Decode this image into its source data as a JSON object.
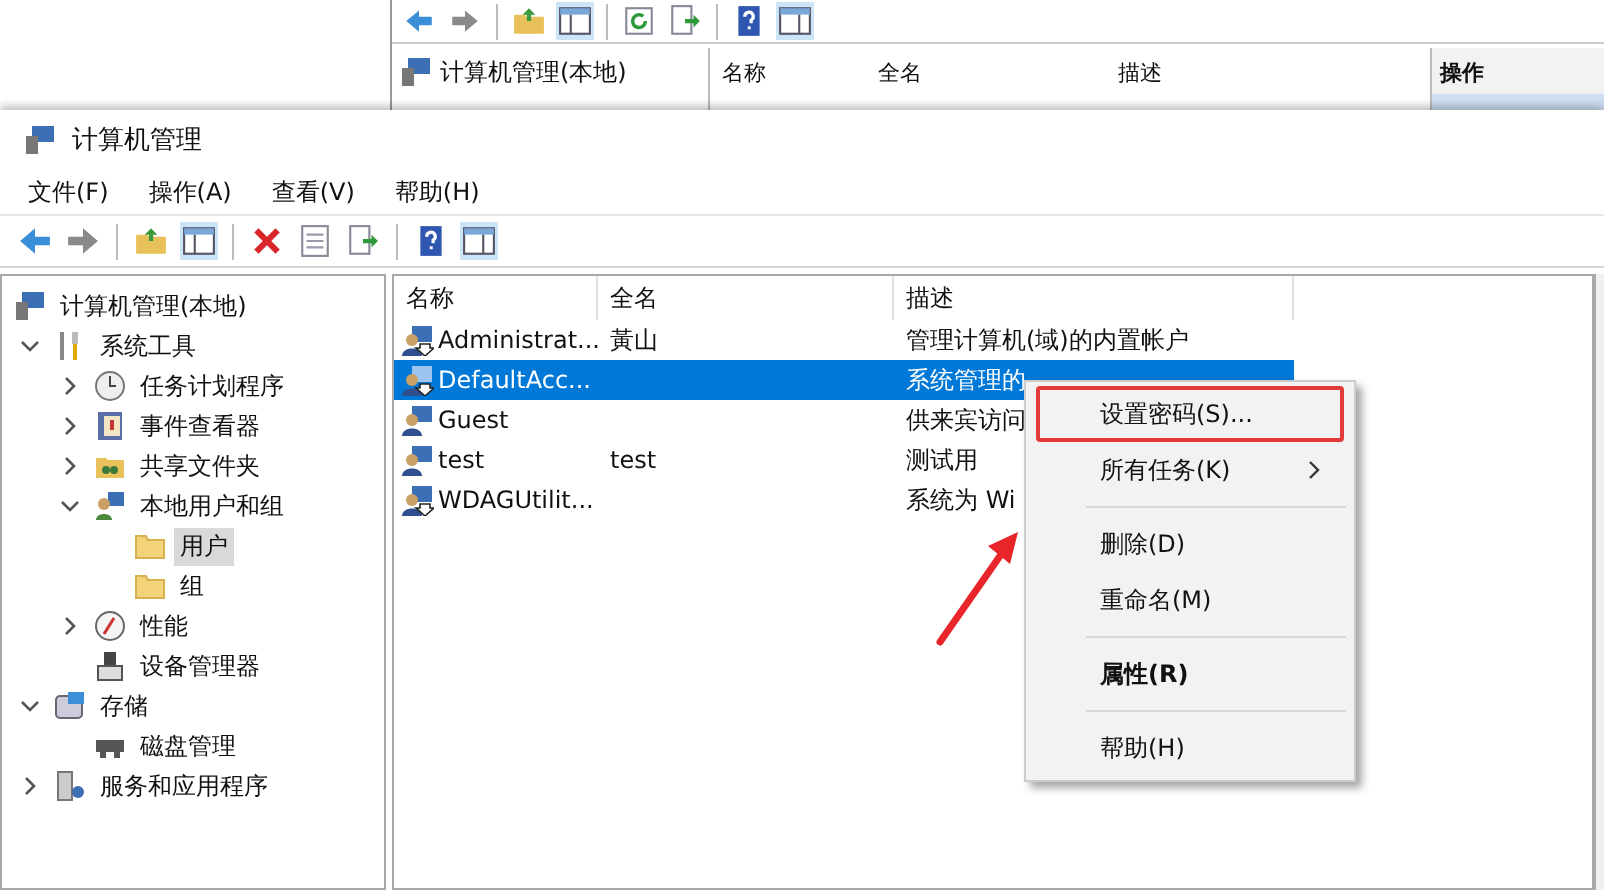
{
  "background_window": {
    "tree_root": "计算机管理(本地)",
    "columns": [
      "名称",
      "全名",
      "描述"
    ],
    "action_pane_title": "操作"
  },
  "window": {
    "title": "计算机管理"
  },
  "menu": [
    "文件(F)",
    "操作(A)",
    "查看(V)",
    "帮助(H)"
  ],
  "tree": {
    "items": [
      {
        "label": "计算机管理(本地)",
        "kind": "computer",
        "selected": false,
        "children": [
          {
            "label": "系统工具",
            "kind": "tools",
            "selected": false,
            "expanded": true,
            "children": [
              {
                "label": "任务计划程序",
                "kind": "clock",
                "selected": false,
                "expanded": false
              },
              {
                "label": "事件查看器",
                "kind": "log",
                "selected": false,
                "expanded": false
              },
              {
                "label": "共享文件夹",
                "kind": "shared-folder",
                "selected": false,
                "expanded": false
              },
              {
                "label": "本地用户和组",
                "kind": "users",
                "selected": false,
                "expanded": true,
                "children": [
                  {
                    "label": "用户",
                    "kind": "folder",
                    "selected": true
                  },
                  {
                    "label": "组",
                    "kind": "folder",
                    "selected": false
                  }
                ]
              },
              {
                "label": "性能",
                "kind": "gauge",
                "selected": false,
                "expanded": false
              },
              {
                "label": "设备管理器",
                "kind": "device",
                "selected": false
              }
            ]
          },
          {
            "label": "存储",
            "kind": "storage",
            "selected": false,
            "expanded": true,
            "children": [
              {
                "label": "磁盘管理",
                "kind": "disk",
                "selected": false
              }
            ]
          },
          {
            "label": "服务和应用程序",
            "kind": "services",
            "selected": false,
            "expanded": false
          }
        ]
      }
    ]
  },
  "table": {
    "columns": [
      "名称",
      "全名",
      "描述"
    ],
    "rows": [
      {
        "name": "Administrat...",
        "full_name": "黃山",
        "description": "管理计算机(域)的内置帐户",
        "disabled": true,
        "selected": false
      },
      {
        "name": "DefaultAcc...",
        "full_name": "",
        "description": "系统管理的",
        "disabled": true,
        "selected": true
      },
      {
        "name": "Guest",
        "full_name": "",
        "description": "供来宾访问",
        "disabled": false,
        "selected": false
      },
      {
        "name": "test",
        "full_name": "test",
        "description": "测试用",
        "disabled": false,
        "selected": false
      },
      {
        "name": "WDAGUtilit...",
        "full_name": "",
        "description": "系统为 Wi",
        "disabled": true,
        "selected": false
      }
    ]
  },
  "context_menu": [
    {
      "kind": "item",
      "label": "设置密码(S)...",
      "annotated": true,
      "bold": false,
      "submenu": false
    },
    {
      "kind": "item",
      "label": "所有任务(K)",
      "annotated": false,
      "bold": false,
      "submenu": true
    },
    {
      "kind": "separator"
    },
    {
      "kind": "item",
      "label": "删除(D)",
      "annotated": false,
      "bold": false,
      "submenu": false
    },
    {
      "kind": "item",
      "label": "重命名(M)",
      "annotated": false,
      "bold": false,
      "submenu": false
    },
    {
      "kind": "separator"
    },
    {
      "kind": "item",
      "label": "属性(R)",
      "annotated": false,
      "bold": true,
      "submenu": false
    },
    {
      "kind": "separator"
    },
    {
      "kind": "item",
      "label": "帮助(H)",
      "annotated": false,
      "bold": false,
      "submenu": false
    }
  ]
}
